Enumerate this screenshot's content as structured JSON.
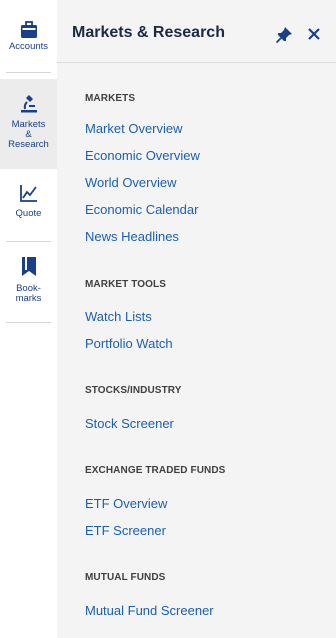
{
  "rail": {
    "accounts": {
      "label": "Accounts",
      "icon": "briefcase-icon"
    },
    "markets": {
      "label_lines": [
        "Markets",
        "&",
        "Research"
      ],
      "icon": "microscope-icon"
    },
    "quote": {
      "label": "Quote",
      "icon": "line-chart-icon"
    },
    "bookmarks": {
      "label_lines": [
        "Book-",
        "marks"
      ],
      "icon": "bookmark-icon"
    }
  },
  "panel": {
    "title": "Markets & Research",
    "pin_icon": "pin-icon",
    "close_icon": "close-icon",
    "sections": [
      {
        "header": "MARKETS",
        "links": [
          "Market Overview",
          "Economic Overview",
          "World Overview",
          "Economic Calendar",
          "News Headlines"
        ]
      },
      {
        "header": "MARKET TOOLS",
        "links": [
          "Watch Lists",
          "Portfolio Watch"
        ]
      },
      {
        "header": "STOCKS/INDUSTRY",
        "links": [
          "Stock Screener"
        ]
      },
      {
        "header": "EXCHANGE TRADED FUNDS",
        "links": [
          "ETF Overview",
          "ETF Screener"
        ]
      },
      {
        "header": "MUTUAL FUNDS",
        "links": [
          "Mutual Fund Screener"
        ]
      }
    ]
  },
  "colors": {
    "link": "#1b5fb5",
    "rail_label": "#1a3f8b",
    "icon": "#1a3f8b",
    "panel_bg": "#f4f4f4",
    "active_bg": "#ececec"
  }
}
